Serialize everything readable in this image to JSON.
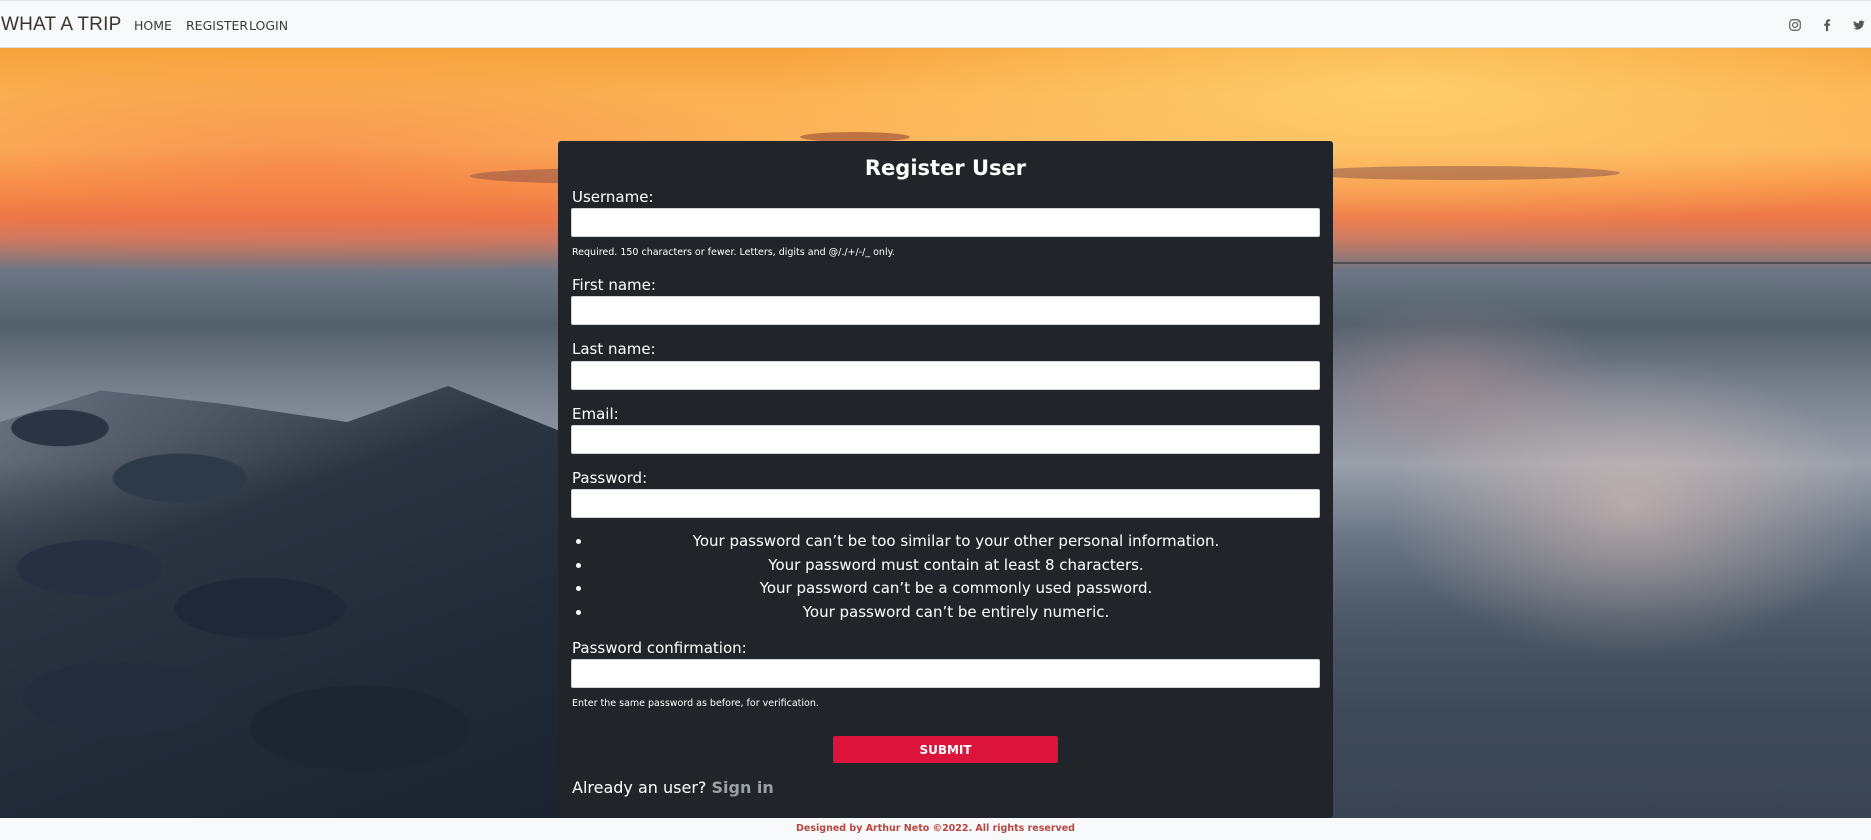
{
  "navbar": {
    "brand": "WHAT A TRIP",
    "links": {
      "home": "HOME",
      "register": "REGISTER",
      "login": "LOGIN"
    },
    "social": [
      "instagram-icon",
      "facebook-icon",
      "twitter-icon"
    ]
  },
  "form": {
    "title": "Register User",
    "username_label": "Username:",
    "username_help": "Required. 150 characters or fewer. Letters, digits and @/./+/-/_ only.",
    "username_value": "",
    "first_name_label": "First name:",
    "first_name_value": "",
    "last_name_label": "Last name:",
    "last_name_value": "",
    "email_label": "Email:",
    "email_value": "",
    "password_label": "Password:",
    "password_value": "",
    "password_rules": [
      "Your password can’t be too similar to your other personal information.",
      "Your password must contain at least 8 characters.",
      "Your password can’t be a commonly used password.",
      "Your password can’t be entirely numeric."
    ],
    "password_confirm_label": "Password confirmation:",
    "password_confirm_help": "Enter the same password as before, for verification.",
    "password_confirm_value": "",
    "submit_label": "SUBMIT",
    "already_text": "Already an user?",
    "signin_label": "Sign in"
  },
  "footer": {
    "text": "Designed by Arthur Neto ©2022. All rights reserved"
  },
  "colors": {
    "accent": "#dc143c",
    "card": "#212529",
    "navbar": "#f8f9fa",
    "footer_text": "#b8463f"
  }
}
